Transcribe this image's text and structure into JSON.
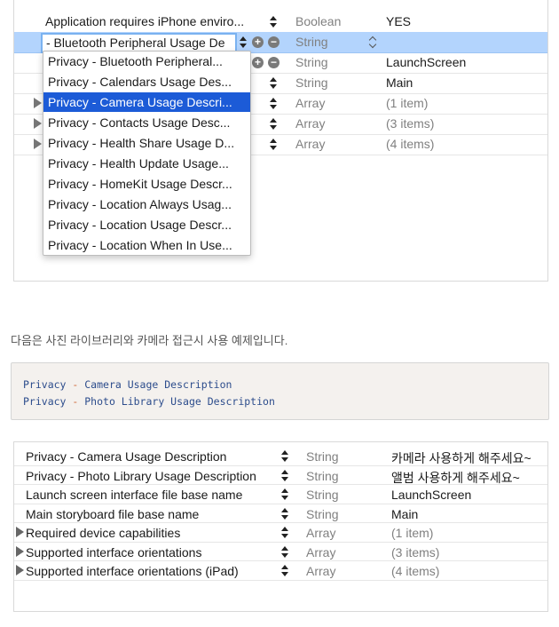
{
  "top_table": {
    "rows": [
      {
        "key": "Application requires iPhone enviro...",
        "type": "Boolean",
        "value": "YES"
      },
      {
        "key": "- Bluetooth Peripheral Usage De",
        "type": "String",
        "value": "",
        "selected": true
      },
      {
        "key": "Privacy - Bluetooth Peripheral...",
        "type": "String",
        "value": "LaunchScreen"
      },
      {
        "key": "",
        "type": "String",
        "value": "Main"
      },
      {
        "key": "",
        "type": "Array",
        "value": "(1 item)"
      },
      {
        "key": "",
        "type": "Array",
        "value": "(3 items)"
      },
      {
        "key": "",
        "type": "Array",
        "value": "(4 items)"
      }
    ],
    "dropdown_items": [
      "Privacy - Bluetooth Peripheral...",
      "Privacy - Calendars Usage Des...",
      "Privacy - Camera Usage Descri...",
      "Privacy - Contacts Usage Desc...",
      "Privacy - Health Share Usage D...",
      "Privacy - Health Update Usage...",
      "Privacy - HomeKit Usage Descr...",
      "Privacy - Location Always Usag...",
      "Privacy - Location Usage Descr...",
      "Privacy - Location When In Use..."
    ],
    "dropdown_highlighted_index": 2,
    "add_symbol": "+",
    "remove_symbol": "−"
  },
  "caption": "다음은 사진 라이브러리와 카메라 접근시 사용 예제입니다.",
  "code": {
    "lines": [
      {
        "a": "Privacy",
        "sep": " - ",
        "b": "Camera Usage Description"
      },
      {
        "a": "Privacy",
        "sep": " - ",
        "b": "Photo Library Usage Description"
      }
    ]
  },
  "bottom_table": {
    "rows": [
      {
        "key": "Privacy - Camera Usage Description",
        "type": "String",
        "value": "카메라 사용하게 해주세요~",
        "expandable": false
      },
      {
        "key": "Privacy - Photo Library Usage Description",
        "type": "String",
        "value": "앨범 사용하게 해주세요~",
        "expandable": false
      },
      {
        "key": "Launch screen interface file base name",
        "type": "String",
        "value": "LaunchScreen",
        "expandable": false
      },
      {
        "key": "Main storyboard file base name",
        "type": "String",
        "value": "Main",
        "expandable": false
      },
      {
        "key": "Required device capabilities",
        "type": "Array",
        "value": "(1 item)",
        "expandable": true
      },
      {
        "key": "Supported interface orientations",
        "type": "Array",
        "value": "(3 items)",
        "expandable": true
      },
      {
        "key": "Supported interface orientations (iPad)",
        "type": "Array",
        "value": "(4 items)",
        "expandable": true
      }
    ]
  },
  "colors": {
    "selection": "#b3d4fd",
    "menu_highlight": "#1c5bd7",
    "code_background": "#f4f1ee",
    "code_keyword": "#2c4c8c",
    "code_separator": "#d06a3a"
  }
}
